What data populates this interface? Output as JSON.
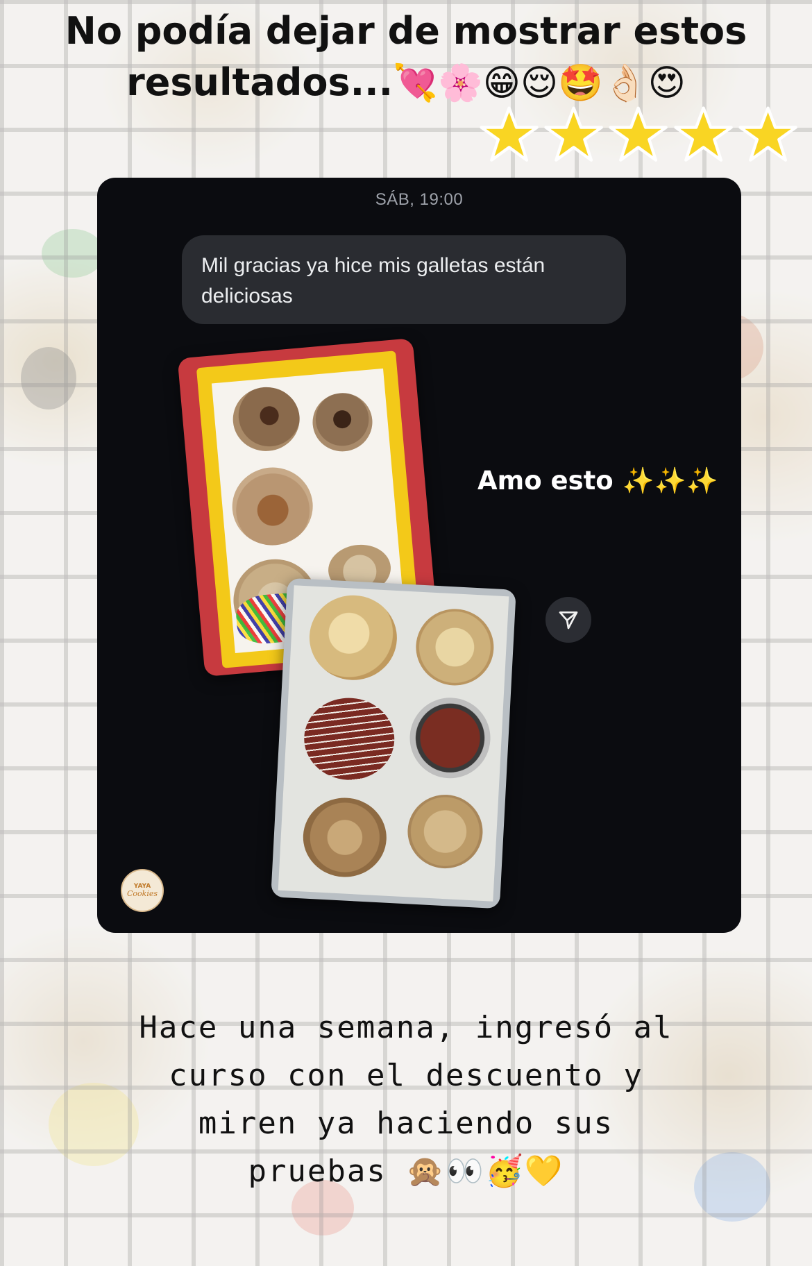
{
  "headline": {
    "line1": "No podía dejar de mostrar estos",
    "line2": "resultados...",
    "emojis": "💘🌸😁😌🤩👌🏻😍"
  },
  "rating": {
    "stars": 5,
    "star_color": "#f9d523"
  },
  "dm": {
    "timestamp": "SÁB, 19:00",
    "message": "Mil gracias ya hice mis galletas están deliciosas",
    "reaction_text": "Amo esto",
    "reaction_emoji": "✨✨✨",
    "share_icon": "send-icon",
    "avatar_text_top": "YAYA",
    "avatar_text_bottom": "Cookies"
  },
  "caption": {
    "line1": "Hace una semana, ingresó al",
    "line2": "curso con el descuento y",
    "line3": "miren ya haciendo sus",
    "line4": "pruebas",
    "emojis": "🙊👀🥳💛"
  },
  "colors": {
    "panel": "#0b0c10",
    "bubble": "#2a2c31",
    "accent_gold": "#f5c542"
  }
}
